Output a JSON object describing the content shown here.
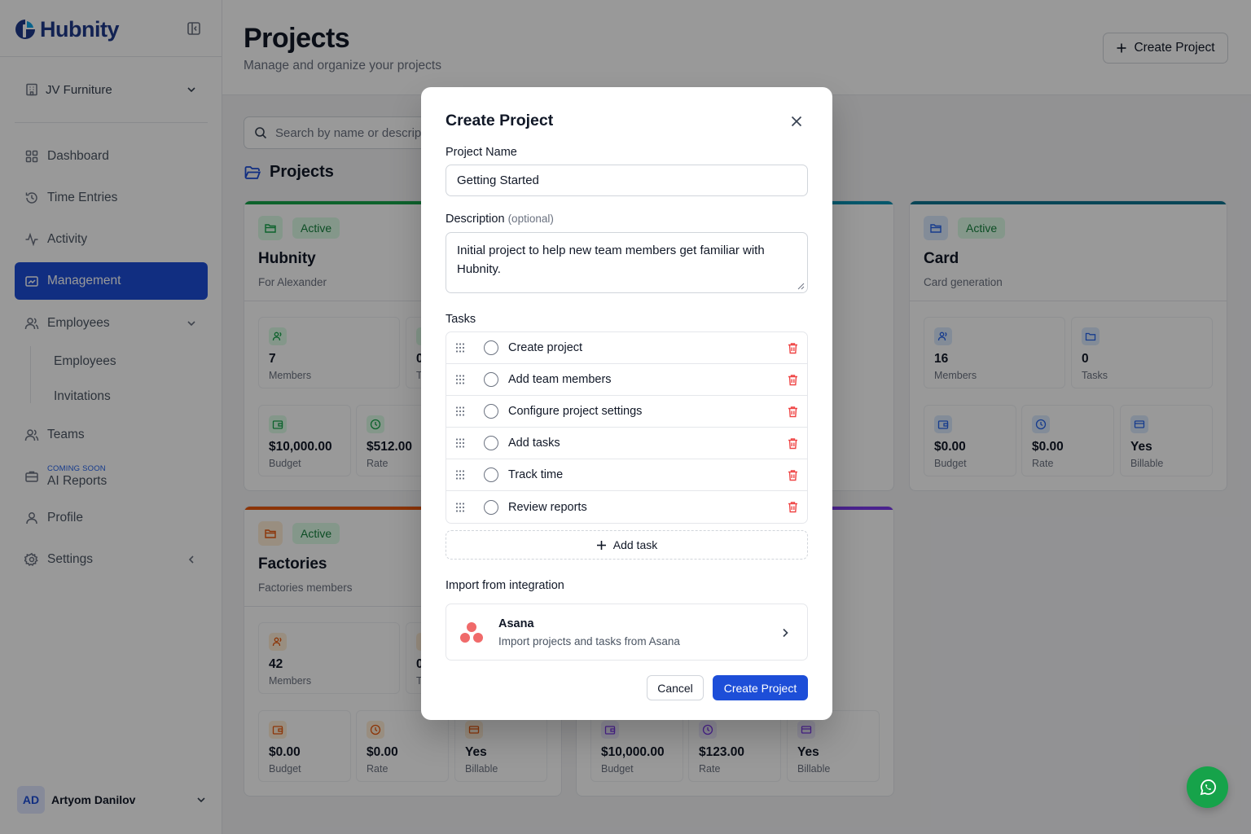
{
  "brand": {
    "name": "Hubnity",
    "logo_icon": "hubnity-logo-icon"
  },
  "colors": {
    "primary": "#1d4ed8",
    "success": "#15803d",
    "danger": "#ef4444",
    "fab": "#16a34a"
  },
  "sidebar": {
    "workspace": "JV Furniture",
    "nav": [
      {
        "label": "Dashboard",
        "icon": "grid-icon"
      },
      {
        "label": "Time Entries",
        "icon": "history-icon"
      },
      {
        "label": "Activity",
        "icon": "activity-icon"
      },
      {
        "label": "Management",
        "icon": "briefcase-icon",
        "active": true
      },
      {
        "label": "Employees",
        "icon": "users-icon"
      },
      {
        "label": "Teams",
        "icon": "users-icon"
      },
      {
        "label": "AI Reports",
        "icon": "briefcase-icon",
        "badge": "COMING SOON"
      },
      {
        "label": "Profile",
        "icon": "user-icon"
      },
      {
        "label": "Settings",
        "icon": "gear-icon"
      }
    ],
    "sub_items": [
      "Employees",
      "Invitations"
    ],
    "user": {
      "initials": "AD",
      "name": "Artyom Danilov"
    }
  },
  "header": {
    "title": "Projects",
    "subtitle": "Manage and organize your projects",
    "create_button": "Create Project"
  },
  "search": {
    "placeholder": "Search by name or descrip"
  },
  "section_title": "Projects",
  "cards": [
    {
      "status": "Active",
      "title": "Hubnity",
      "subtitle": "For Alexander",
      "accent": "#16a34a",
      "stats": [
        {
          "value": "7",
          "label": "Members"
        },
        {
          "value": "0",
          "label": "T"
        },
        {
          "value": "$10,000.00",
          "label": "Budget"
        },
        {
          "value": "$512.00",
          "label": "Rate"
        }
      ]
    },
    {
      "status": "Active",
      "title": "Card",
      "subtitle": "Card generation",
      "accent": "#0e7490",
      "stats": [
        {
          "value": "16",
          "label": "Members"
        },
        {
          "value": "0",
          "label": "Tasks"
        },
        {
          "value": "$0.00",
          "label": "Budget"
        },
        {
          "value": "$0.00",
          "label": "Rate"
        },
        {
          "value": "Yes",
          "label": "Billable"
        }
      ]
    },
    {
      "status": "Active",
      "title": "Factories",
      "subtitle": "Factories members",
      "accent": "#ea580c",
      "stats": [
        {
          "value": "42",
          "label": "Members"
        },
        {
          "value": "0",
          "label": "T"
        },
        {
          "value": "$0.00",
          "label": "Budget"
        },
        {
          "value": "$0.00",
          "label": "Rate"
        },
        {
          "value": "Yes",
          "label": "Billable"
        }
      ]
    },
    {
      "accent": "#7c3aed",
      "stats": [
        {
          "value": "$10,000.00",
          "label": "Budget"
        },
        {
          "value": "$123.00",
          "label": "Rate"
        },
        {
          "value": "Yes",
          "label": "Billable"
        }
      ]
    }
  ],
  "modal": {
    "title": "Create Project",
    "name_label": "Project Name",
    "name_value": "Getting Started",
    "desc_label": "Description",
    "desc_optional": "(optional)",
    "desc_value": "Initial project to help new team members get familiar with Hubnity.",
    "tasks_label": "Tasks",
    "tasks": [
      "Create project",
      "Add team members",
      "Configure project settings",
      "Add tasks",
      "Track time",
      "Review reports"
    ],
    "add_task": "Add task",
    "import_label": "Import from integration",
    "integration": {
      "name": "Asana",
      "description": "Import projects and tasks from Asana",
      "icon": "asana-logo-icon"
    },
    "cancel": "Cancel",
    "create": "Create Project"
  },
  "fab": {
    "icon": "whatsapp-icon"
  }
}
